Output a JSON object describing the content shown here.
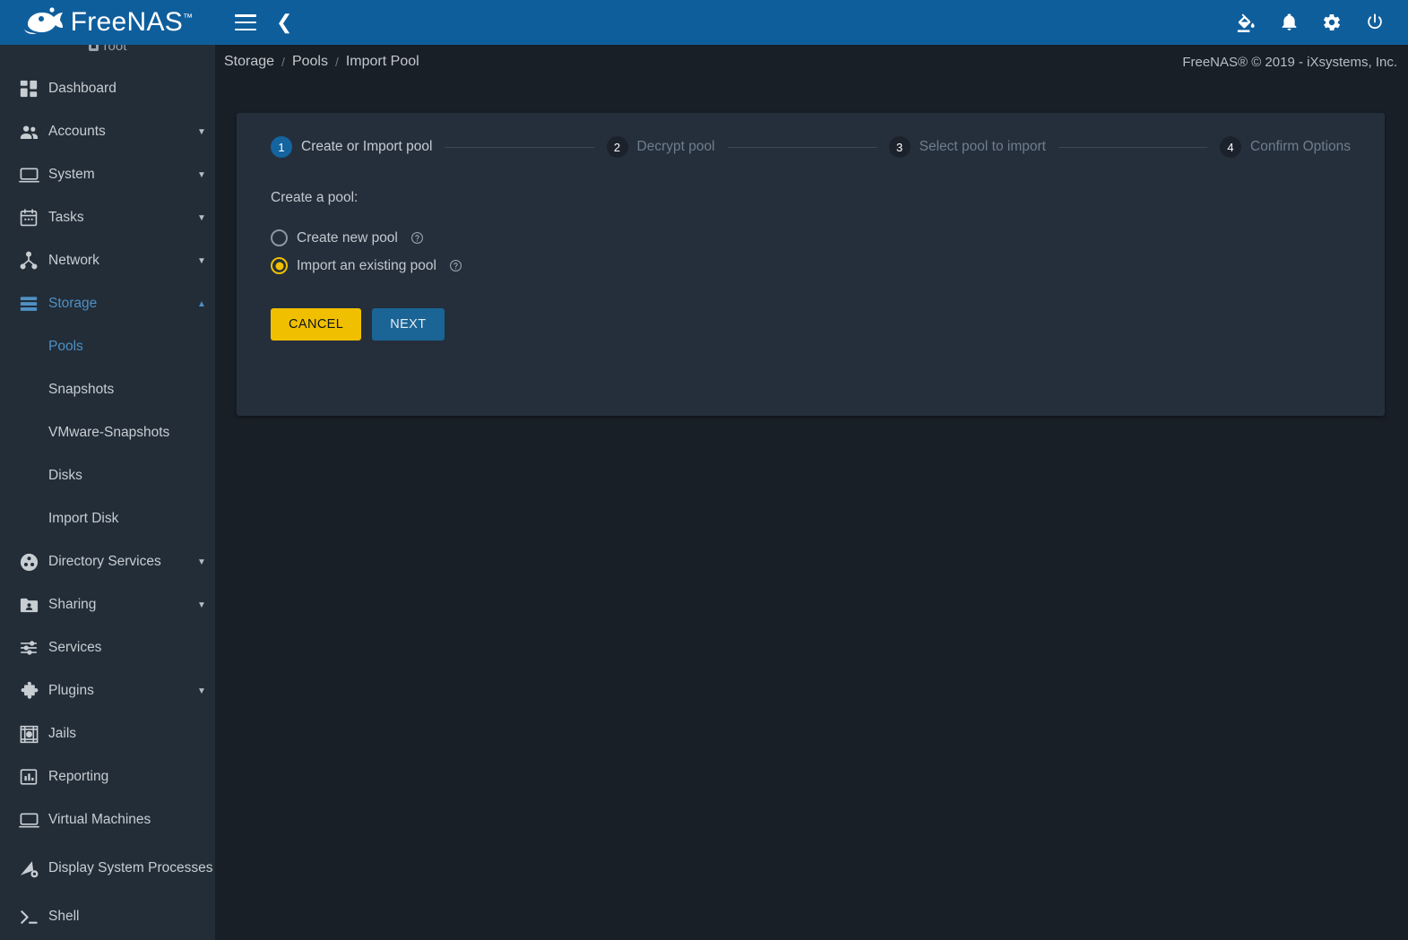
{
  "app": {
    "brand_name": "FreeNAS",
    "brand_trademark": "™",
    "user_label": "root"
  },
  "topbar": {
    "menu_icon": "hamburger-menu-icon",
    "back_icon": "chevron-left-icon",
    "icons": [
      {
        "name": "theme-paint-bucket-icon",
        "label": "Change Theme"
      },
      {
        "name": "notifications-bell-icon",
        "label": "Notifications"
      },
      {
        "name": "settings-gear-icon",
        "label": "Settings"
      },
      {
        "name": "power-icon",
        "label": "Power"
      }
    ]
  },
  "breadcrumb": {
    "items": [
      "Storage",
      "Pools",
      "Import Pool"
    ],
    "separator": "/"
  },
  "footer": {
    "copyright": "FreeNAS® © 2019 - iXsystems, Inc."
  },
  "sidebar": {
    "items": [
      {
        "label": "Dashboard",
        "icon": "dashboard-icon",
        "expandable": false,
        "state": "normal",
        "sub": false
      },
      {
        "label": "Accounts",
        "icon": "accounts-people-icon",
        "expandable": true,
        "state": "normal",
        "sub": false,
        "caret": "▼"
      },
      {
        "label": "System",
        "icon": "system-monitor-icon",
        "expandable": true,
        "state": "normal",
        "sub": false,
        "caret": "▼"
      },
      {
        "label": "Tasks",
        "icon": "tasks-calendar-icon",
        "expandable": true,
        "state": "normal",
        "sub": false,
        "caret": "▼"
      },
      {
        "label": "Network",
        "icon": "network-nodes-icon",
        "expandable": true,
        "state": "normal",
        "sub": false,
        "caret": "▼"
      },
      {
        "label": "Storage",
        "icon": "storage-stack-icon",
        "expandable": true,
        "state": "active",
        "sub": false,
        "caret": "▲"
      },
      {
        "label": "Pools",
        "icon": "",
        "expandable": false,
        "state": "active",
        "sub": true
      },
      {
        "label": "Snapshots",
        "icon": "",
        "expandable": false,
        "state": "normal",
        "sub": true
      },
      {
        "label": "VMware-Snapshots",
        "icon": "",
        "expandable": false,
        "state": "normal",
        "sub": true
      },
      {
        "label": "Disks",
        "icon": "",
        "expandable": false,
        "state": "normal",
        "sub": true
      },
      {
        "label": "Import Disk",
        "icon": "",
        "expandable": false,
        "state": "normal",
        "sub": true
      },
      {
        "label": "Directory Services",
        "icon": "directory-services-icon",
        "expandable": true,
        "state": "normal",
        "sub": false,
        "caret": "▼"
      },
      {
        "label": "Sharing",
        "icon": "sharing-folder-icon",
        "expandable": true,
        "state": "normal",
        "sub": false,
        "caret": "▼"
      },
      {
        "label": "Services",
        "icon": "services-sliders-icon",
        "expandable": false,
        "state": "normal",
        "sub": false
      },
      {
        "label": "Plugins",
        "icon": "plugins-puzzle-icon",
        "expandable": true,
        "state": "normal",
        "sub": false,
        "caret": "▼"
      },
      {
        "label": "Jails",
        "icon": "jails-icon",
        "expandable": false,
        "state": "normal",
        "sub": false
      },
      {
        "label": "Reporting",
        "icon": "reporting-chart-icon",
        "expandable": false,
        "state": "normal",
        "sub": false
      },
      {
        "label": "Virtual Machines",
        "icon": "virtual-machines-icon",
        "expandable": false,
        "state": "normal",
        "sub": false
      },
      {
        "label": "Display System Processes",
        "icon": "system-processes-icon",
        "expandable": false,
        "state": "normal",
        "sub": false,
        "tall": true
      },
      {
        "label": "Shell",
        "icon": "shell-prompt-icon",
        "expandable": false,
        "state": "normal",
        "sub": false
      }
    ]
  },
  "wizard": {
    "steps": [
      {
        "number": "1",
        "label": "Create or Import pool",
        "current": true
      },
      {
        "number": "2",
        "label": "Decrypt pool",
        "current": false
      },
      {
        "number": "3",
        "label": "Select pool to import",
        "current": false
      },
      {
        "number": "4",
        "label": "Confirm Options",
        "current": false
      }
    ],
    "form": {
      "title": "Create a pool:",
      "options": [
        {
          "label": "Create new pool",
          "checked": false,
          "help_icon": "help-circle-icon"
        },
        {
          "label": "Import an existing pool",
          "checked": true,
          "help_icon": "help-circle-icon"
        }
      ],
      "buttons": {
        "cancel": "CANCEL",
        "next": "NEXT"
      }
    }
  },
  "colors": {
    "topbar_blue": "#0f5e9c",
    "sidebar_bg": "#222d38",
    "page_bg": "#181f27",
    "card_bg": "#252f3c",
    "accent_blue": "#1464a0",
    "accent_yellow": "#f0c000",
    "active_link": "#4f90c4",
    "muted_text": "#6f7d8b",
    "body_text": "#c2c8ce"
  }
}
